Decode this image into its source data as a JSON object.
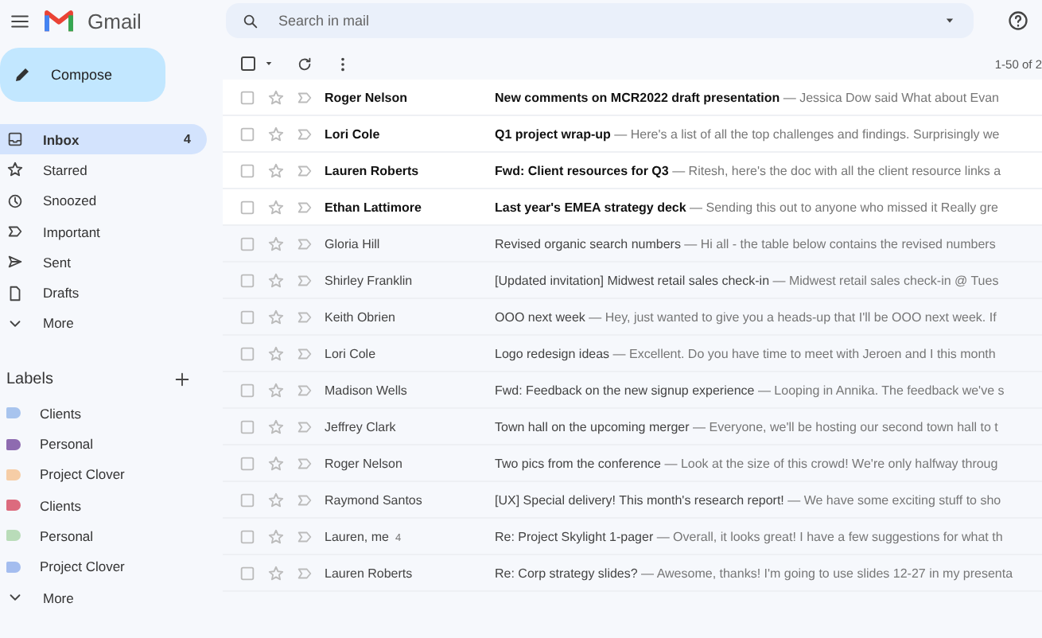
{
  "app": {
    "name": "Gmail"
  },
  "search": {
    "placeholder": "Search in mail"
  },
  "compose": {
    "label": "Compose"
  },
  "folders": [
    {
      "kind": "inbox",
      "label": "Inbox",
      "count": "4",
      "selected": true
    },
    {
      "kind": "star",
      "label": "Starred",
      "selected": false
    },
    {
      "kind": "clock",
      "label": "Snoozed",
      "selected": false
    },
    {
      "kind": "important",
      "label": "Important",
      "selected": false
    },
    {
      "kind": "sent",
      "label": "Sent",
      "selected": false
    },
    {
      "kind": "draft",
      "label": "Drafts",
      "selected": false
    },
    {
      "kind": "more",
      "label": "More",
      "selected": false
    }
  ],
  "labels": {
    "title": "Labels",
    "items": [
      {
        "label": "Clients",
        "color": "#a8c4ee"
      },
      {
        "label": "Personal",
        "color": "#8e6bb0"
      },
      {
        "label": "Project Clover",
        "color": "#f6cda6"
      },
      {
        "label": "Clients",
        "color": "#dc6b7e"
      },
      {
        "label": "Personal",
        "color": "#b9dcb9"
      },
      {
        "label": "Project Clover",
        "color": "#a4bdef"
      }
    ],
    "more": "More"
  },
  "pagination": "1-50 of 2",
  "emails": [
    {
      "sender": "Roger Nelson",
      "subject": "New comments on MCR2022 draft presentation",
      "snippet": " — Jessica Dow said What about Evan",
      "unread": true
    },
    {
      "sender": "Lori Cole",
      "subject": "Q1 project wrap-up",
      "snippet": " — Here's a list of all the top challenges and findings. Surprisingly we",
      "unread": true
    },
    {
      "sender": "Lauren Roberts",
      "subject": "Fwd: Client resources for Q3",
      "snippet": " — Ritesh, here's the doc with all the client resource links a",
      "unread": true
    },
    {
      "sender": "Ethan Lattimore",
      "subject": "Last year's EMEA strategy deck",
      "snippet": " — Sending this out to anyone who missed it Really gre",
      "unread": true
    },
    {
      "sender": "Gloria Hill",
      "subject": "Revised organic search numbers",
      "snippet": " — Hi all - the table below contains the revised numbers",
      "unread": false
    },
    {
      "sender": "Shirley Franklin",
      "subject": "[Updated invitation] Midwest retail sales check-in",
      "snippet": " — Midwest retail sales check-in @ Tues",
      "unread": false
    },
    {
      "sender": "Keith Obrien",
      "subject": "OOO next week",
      "snippet": " — Hey, just wanted to give you a heads-up that I'll be OOO next week. If",
      "unread": false
    },
    {
      "sender": "Lori Cole",
      "subject": "Logo redesign ideas",
      "snippet": " — Excellent. Do you have time to meet with Jeroen and I this month",
      "unread": false
    },
    {
      "sender": "Madison Wells",
      "subject": "Fwd: Feedback on the new signup experience",
      "snippet": " — Looping in Annika. The feedback we've s",
      "unread": false
    },
    {
      "sender": "Jeffrey Clark",
      "subject": "Town hall on the upcoming merger",
      "snippet": " — Everyone, we'll be hosting our second town hall to t",
      "unread": false
    },
    {
      "sender": "Roger Nelson",
      "subject": "Two pics from the conference",
      "snippet": " — Look at the size of this crowd! We're only halfway throug",
      "unread": false
    },
    {
      "sender": "Raymond Santos",
      "subject": "[UX] Special delivery! This month's research report!",
      "snippet": " — We have some exciting stuff to sho",
      "unread": false
    },
    {
      "sender": "Lauren, me",
      "thread_count": "4",
      "subject": "Re: Project Skylight 1-pager",
      "snippet": " — Overall, it looks great! I have a few suggestions for what th",
      "unread": false
    },
    {
      "sender": "Lauren Roberts",
      "subject": "Re: Corp strategy slides?",
      "snippet": " — Awesome, thanks! I'm going to use slides 12-27 in my presenta",
      "unread": false
    }
  ]
}
